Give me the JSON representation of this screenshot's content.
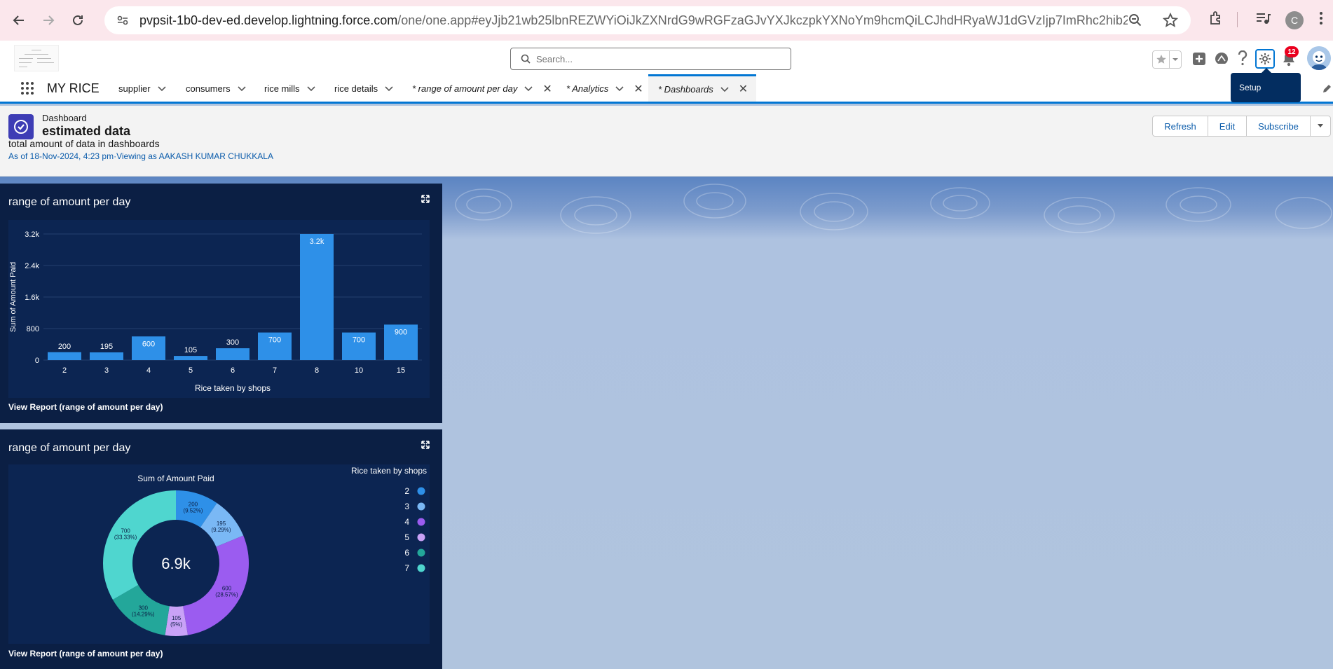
{
  "browser": {
    "url_host": "pvpsit-1b0-dev-ed.develop.lightning.force.com",
    "url_rest": "/one/one.app#eyJjb21wb25lbnREZWYiOiJkZXNrdG9wRGFzaGJvYXJkczpkYXNoYm9hcmQiLCJhdHRyaWJ1dGVzIjp7ImRhc2hib2FyZElkIjo...",
    "profile_initial": "C"
  },
  "header": {
    "search_placeholder": "Search...",
    "notification_count": "12",
    "setup_tooltip": "Setup"
  },
  "nav": {
    "app_name": "MY RICE",
    "items": [
      {
        "label": "supplier"
      },
      {
        "label": "consumers"
      },
      {
        "label": "rice mills"
      },
      {
        "label": "rice details"
      }
    ],
    "tabs": [
      {
        "label": "* range of amount per day"
      },
      {
        "label": "* Analytics"
      },
      {
        "label": "* Dashboards"
      }
    ]
  },
  "dashboard": {
    "type_label": "Dashboard",
    "title": "estimated data",
    "description": "total amount of data in dashboards",
    "as_of": "As of 18-Nov-2024, 4:23 pm·Viewing as AAKASH KUMAR CHUKKALA",
    "buttons": {
      "refresh": "Refresh",
      "edit": "Edit",
      "subscribe": "Subscribe"
    }
  },
  "widgets": [
    {
      "title": "range of amount per day",
      "view_report": "View Report (range of amount per day)"
    },
    {
      "title": "range of amount per day",
      "view_report": "View Report (range of amount per day)"
    }
  ],
  "colors": {
    "bar": "#2e90e8",
    "widget_bg": "#0b1f44",
    "chart_bg": "#0c2552",
    "brand_blue": "#0176d3"
  },
  "chart_data": [
    {
      "type": "bar",
      "xlabel": "Rice taken by shops",
      "ylabel": "Sum of Amount Paid",
      "categories": [
        "2",
        "3",
        "4",
        "5",
        "6",
        "7",
        "8",
        "10",
        "15"
      ],
      "values": [
        200,
        195,
        600,
        105,
        300,
        700,
        3200,
        700,
        900
      ],
      "value_labels": [
        "200",
        "195",
        "600",
        "105",
        "300",
        "700",
        "3.2k",
        "700",
        "900"
      ],
      "yticks": [
        {
          "value": 0,
          "label": "0"
        },
        {
          "value": 800,
          "label": "800"
        },
        {
          "value": 1600,
          "label": "1.6k"
        },
        {
          "value": 2400,
          "label": "2.4k"
        },
        {
          "value": 3200,
          "label": "3.2k"
        }
      ],
      "ylim": [
        0,
        3200
      ],
      "grid": true
    },
    {
      "type": "pie",
      "title": "Sum of Amount Paid",
      "center_label": "6.9k",
      "legend_title": "Rice taken by shops",
      "legend_position": "top-right",
      "slices": [
        {
          "name": "2",
          "value": 200,
          "label": "200",
          "pct": "(9.52%)",
          "color": "#2e90e8"
        },
        {
          "name": "3",
          "value": 195,
          "label": "195",
          "pct": "(9.29%)",
          "color": "#7ab8f5"
        },
        {
          "name": "4",
          "value": 600,
          "label": "600",
          "pct": "(28.57%)",
          "color": "#9b5cf0"
        },
        {
          "name": "5",
          "value": 105,
          "label": "105",
          "pct": "(5%)",
          "color": "#c9a2f7"
        },
        {
          "name": "6",
          "value": 300,
          "label": "300",
          "pct": "(14.29%)",
          "color": "#23a79a"
        },
        {
          "name": "7",
          "value": 700,
          "label": "700",
          "pct": "(33.33%)",
          "color": "#4fd6cf"
        }
      ]
    }
  ]
}
